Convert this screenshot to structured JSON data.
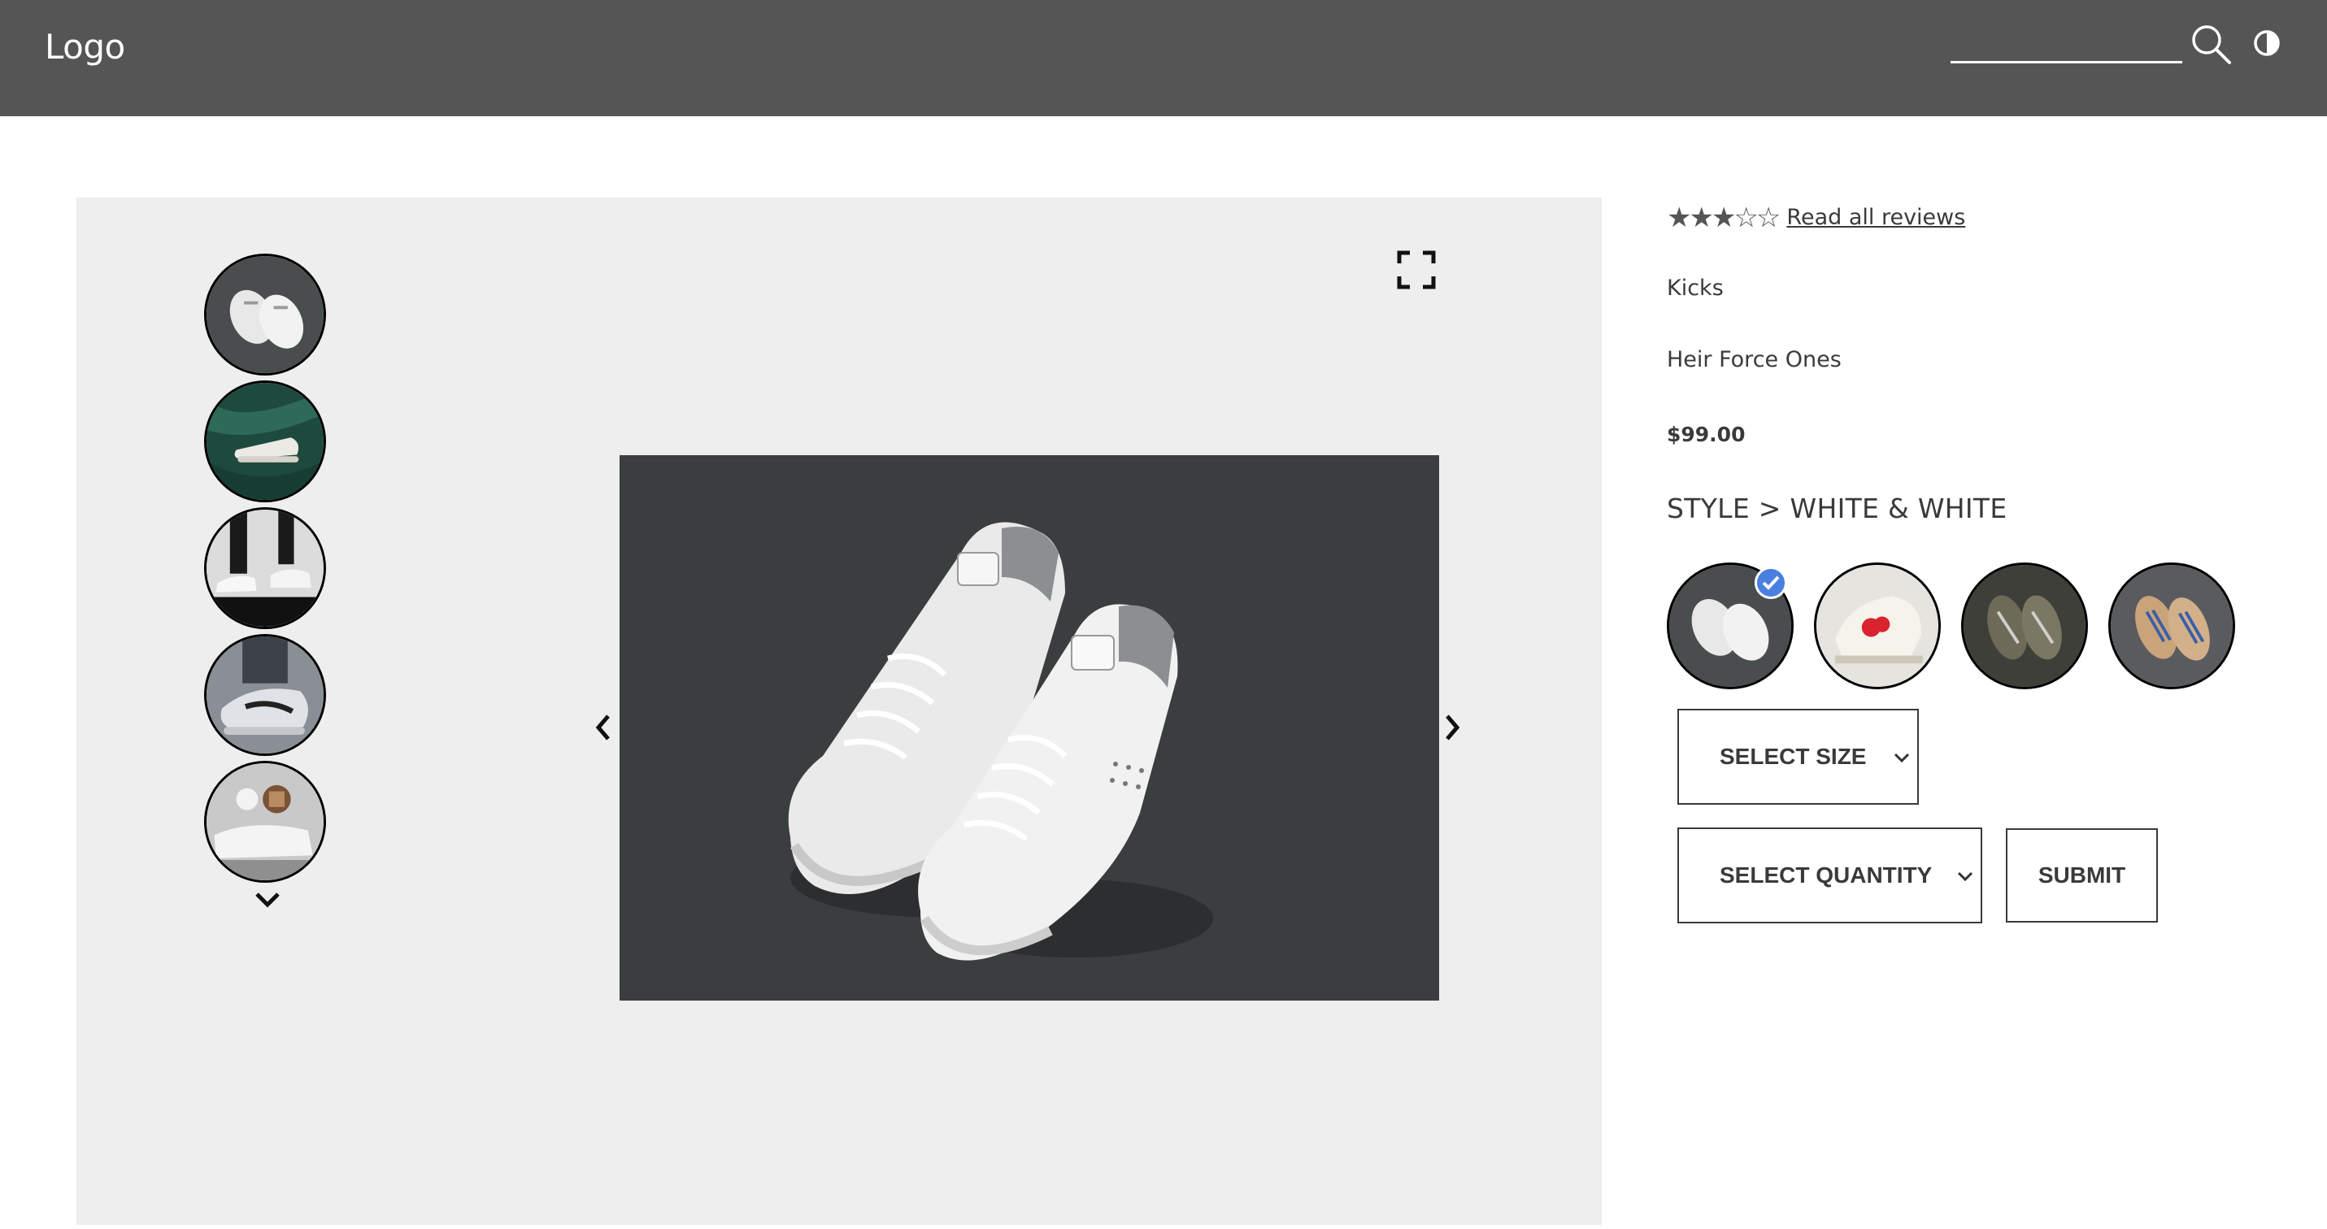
{
  "header": {
    "logo": "Logo",
    "search": {
      "value": "",
      "placeholder": ""
    },
    "icons": [
      "search-icon",
      "contrast-icon"
    ]
  },
  "gallery": {
    "thumbnails": [
      {
        "name": "thumb-white-sneakers-dark"
      },
      {
        "name": "thumb-sneaker-green-velvet"
      },
      {
        "name": "thumb-sneakers-walking"
      },
      {
        "name": "thumb-sneaker-closeup"
      },
      {
        "name": "thumb-sneakers-coffee"
      }
    ],
    "icons": [
      "chevron-down-icon",
      "fullscreen-icon",
      "chevron-left-icon",
      "chevron-right-icon"
    ]
  },
  "product": {
    "rating": {
      "stars": "★★★☆☆",
      "value": 3,
      "max": 5
    },
    "reviews_link": "Read all reviews",
    "brand": "Kicks",
    "name": "Heir Force Ones",
    "price": "$99.00",
    "style_label": "STYLE > WHITE & WHITE",
    "styles": [
      {
        "name": "white-white",
        "selected": true
      },
      {
        "name": "cream-red-logo",
        "selected": false
      },
      {
        "name": "olive-grey",
        "selected": false
      },
      {
        "name": "tan-blue-stripes",
        "selected": false
      }
    ],
    "size_select": "SELECT SIZE",
    "quantity_select": "SELECT QUANTITY",
    "submit": "SUBMIT"
  },
  "colors": {
    "header_bg": "#555555",
    "gallery_bg": "#eeeeee",
    "check_blue": "#4a7fe0"
  }
}
